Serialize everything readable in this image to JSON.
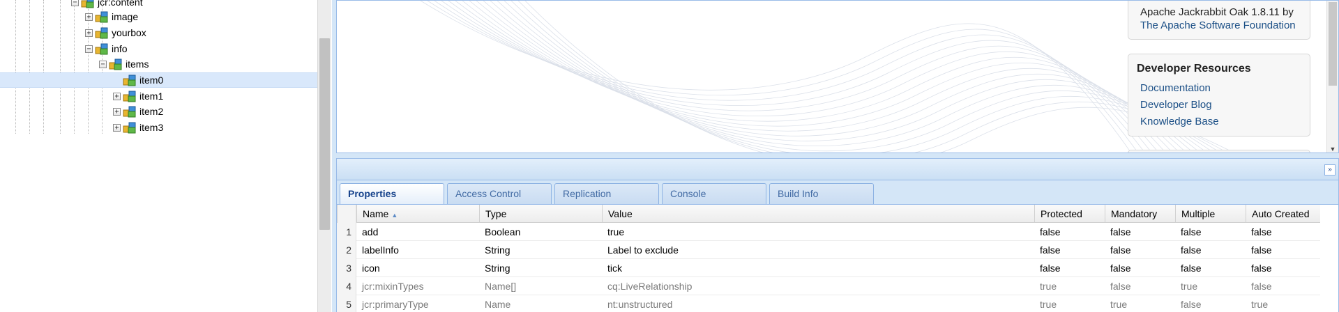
{
  "tree": {
    "nodes": [
      {
        "label": "jcr:content",
        "toggle": "−"
      },
      {
        "label": "image",
        "toggle": "+"
      },
      {
        "label": "yourbox",
        "toggle": "+"
      },
      {
        "label": "info",
        "toggle": "−"
      },
      {
        "label": "items",
        "toggle": "−"
      },
      {
        "label": "item0",
        "toggle": ""
      },
      {
        "label": "item1",
        "toggle": "+"
      },
      {
        "label": "item2",
        "toggle": "+"
      },
      {
        "label": "item3",
        "toggle": "+"
      }
    ]
  },
  "welcome": {
    "oak_line1": "Apache Jackrabbit Oak 1.8.11 by",
    "oak_link": "The Apache Software Foundation",
    "dev_title": "Developer Resources",
    "dev_links": [
      "Documentation",
      "Developer Blog",
      "Knowledge Base"
    ]
  },
  "tabs": [
    "Properties",
    "Access Control",
    "Replication",
    "Console",
    "Build Info"
  ],
  "grid": {
    "headers": [
      "Name",
      "Type",
      "Value",
      "Protected",
      "Mandatory",
      "Multiple",
      "Auto Created"
    ],
    "sort_indicator": "▲",
    "rows": [
      {
        "num": "1",
        "name": "add",
        "type": "Boolean",
        "value": "true",
        "protected": "false",
        "mandatory": "false",
        "multiple": "false",
        "auto": "false"
      },
      {
        "num": "2",
        "name": "labelInfo",
        "type": "String",
        "value": "Label to exclude",
        "protected": "false",
        "mandatory": "false",
        "multiple": "false",
        "auto": "false"
      },
      {
        "num": "3",
        "name": "icon",
        "type": "String",
        "value": "tick",
        "protected": "false",
        "mandatory": "false",
        "multiple": "false",
        "auto": "false"
      },
      {
        "num": "4",
        "name": "jcr:mixinTypes",
        "type": "Name[]",
        "value": "cq:LiveRelationship",
        "protected": "true",
        "mandatory": "false",
        "multiple": "true",
        "auto": "false"
      },
      {
        "num": "5",
        "name": "jcr:primaryType",
        "type": "Name",
        "value": "nt:unstructured",
        "protected": "true",
        "mandatory": "true",
        "multiple": "false",
        "auto": "true"
      }
    ]
  },
  "icons": {
    "collapse": "double-chevron-down-icon",
    "scroll_down": "triangle-down-icon",
    "node": "jcr-node-icon"
  },
  "colors": {
    "selection": "#d9e8fb",
    "panel_border": "#99bbe8",
    "active_tab_text": "#15428b",
    "link": "#1b4f86"
  }
}
